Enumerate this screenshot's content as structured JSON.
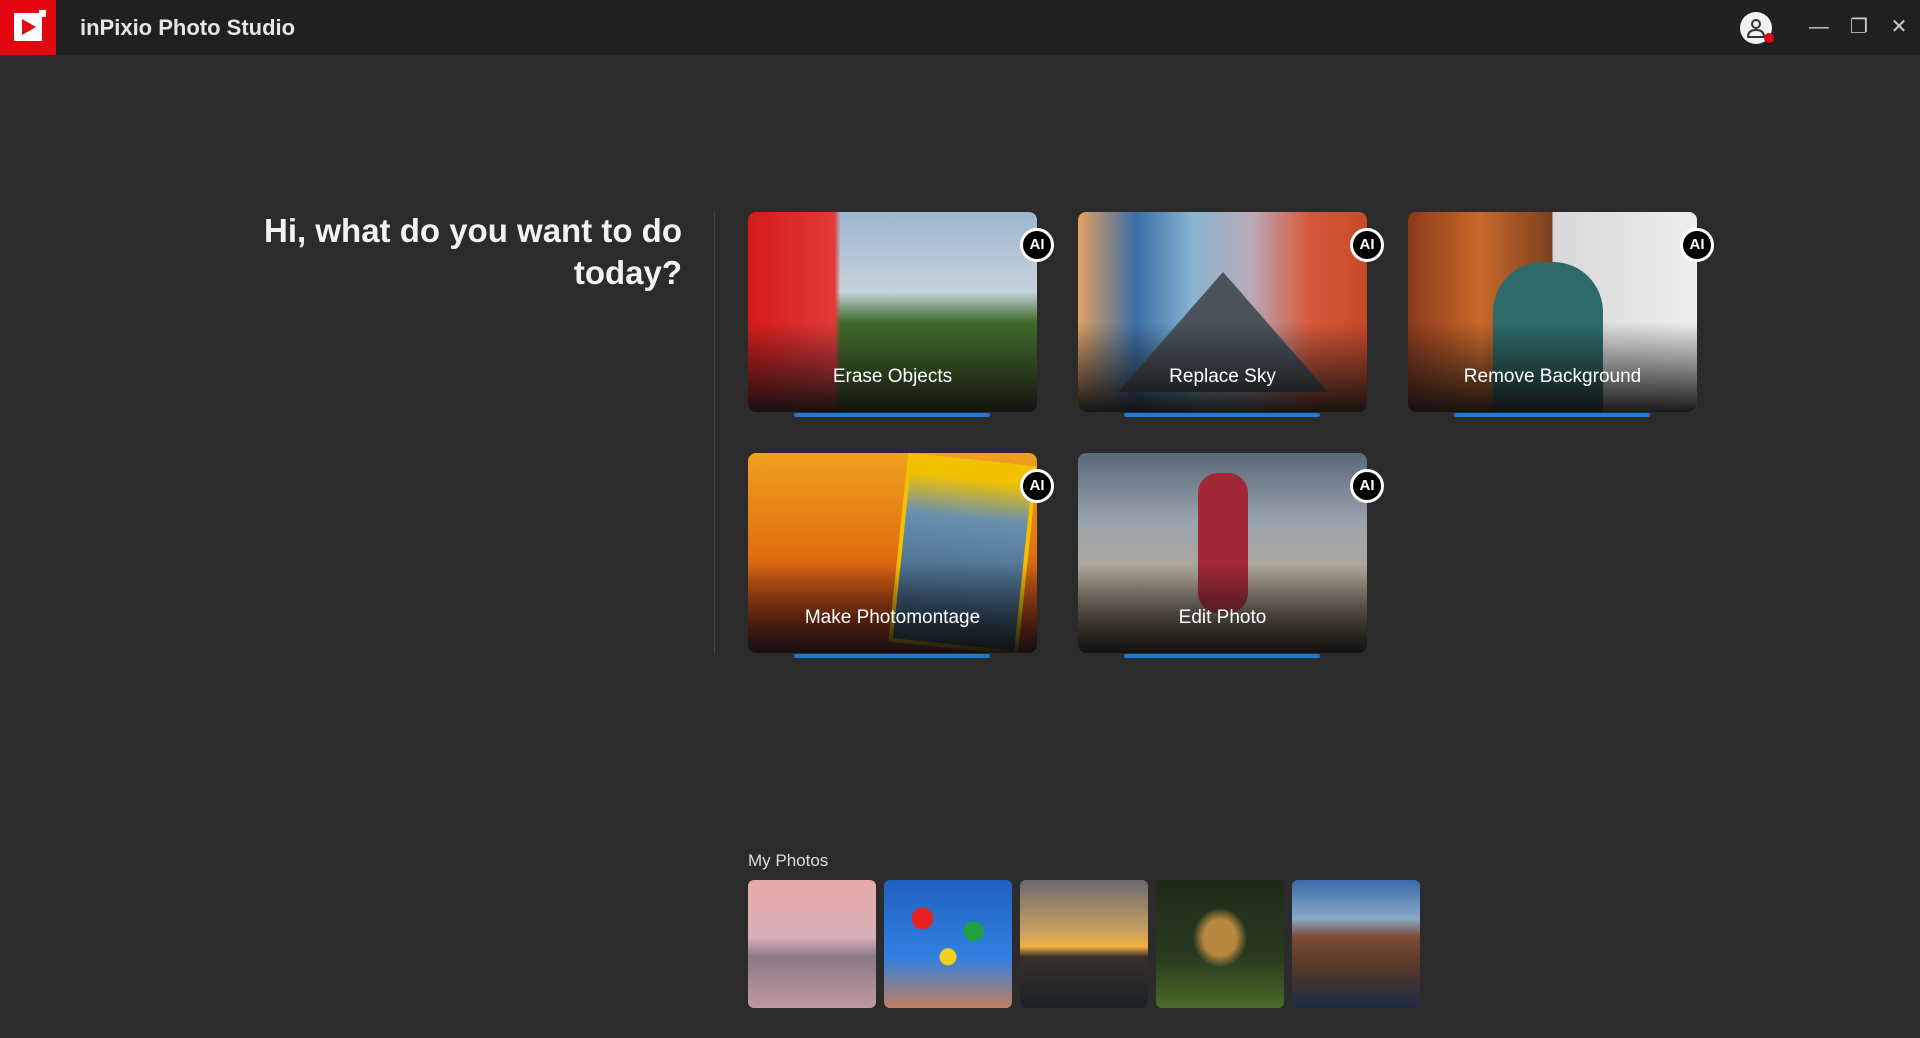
{
  "app": {
    "title": "inPixio Photo Studio",
    "brand_color": "#e30613",
    "accent_color": "#1e7ad3"
  },
  "window_controls": {
    "minimize_icon": "minimize-icon",
    "restore_icon": "restore-icon",
    "close_icon": "close-icon",
    "minimize": "—",
    "restore": "❐",
    "close": "✕"
  },
  "heading": "Hi, what do you want to do today?",
  "cards": [
    {
      "label": "Erase Objects",
      "badge": "AI"
    },
    {
      "label": "Replace Sky",
      "badge": "AI"
    },
    {
      "label": "Remove Background",
      "badge": "AI"
    },
    {
      "label": "Make Photomontage",
      "badge": "AI"
    },
    {
      "label": "Edit Photo",
      "badge": "AI"
    }
  ],
  "my_photos": {
    "title": "My Photos",
    "count": 5
  }
}
